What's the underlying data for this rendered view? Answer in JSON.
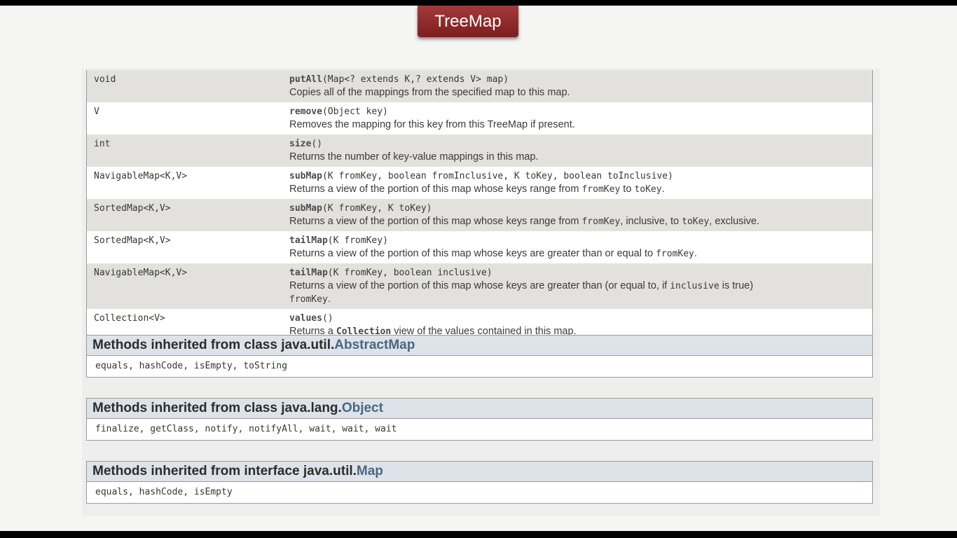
{
  "slide_title": "TreeMap",
  "methods": [
    {
      "type": "void",
      "name": "putAll",
      "params": "(Map<? extends K,? extends V> map)",
      "desc": [
        {
          "t": "Copies all of the mappings from the specified map to this map."
        }
      ]
    },
    {
      "type": "V",
      "name": "remove",
      "params": "(Object key)",
      "desc": [
        {
          "t": "Removes the mapping for this key from this TreeMap if present."
        }
      ]
    },
    {
      "type": "int",
      "name": "size",
      "params": "()",
      "desc": [
        {
          "t": "Returns the number of key-value mappings in this map."
        }
      ]
    },
    {
      "type": "NavigableMap<K,V>",
      "name": "subMap",
      "params": "(K fromKey, boolean fromInclusive, K toKey, boolean toInclusive)",
      "desc": [
        {
          "t": "Returns a view of the portion of this map whose keys range from "
        },
        {
          "t": "fromKey",
          "code": true
        },
        {
          "t": " to "
        },
        {
          "t": "toKey",
          "code": true
        },
        {
          "t": "."
        }
      ]
    },
    {
      "type": "SortedMap<K,V>",
      "name": "subMap",
      "params": "(K fromKey, K toKey)",
      "desc": [
        {
          "t": "Returns a view of the portion of this map whose keys range from "
        },
        {
          "t": "fromKey",
          "code": true
        },
        {
          "t": ", inclusive, to "
        },
        {
          "t": "toKey",
          "code": true
        },
        {
          "t": ", exclusive."
        }
      ]
    },
    {
      "type": "SortedMap<K,V>",
      "name": "tailMap",
      "params": "(K fromKey)",
      "desc": [
        {
          "t": "Returns a view of the portion of this map whose keys are greater than or equal to "
        },
        {
          "t": "fromKey",
          "code": true
        },
        {
          "t": "."
        }
      ]
    },
    {
      "type": "NavigableMap<K,V>",
      "name": "tailMap",
      "params": "(K fromKey, boolean inclusive)",
      "desc": [
        {
          "t": "Returns a view of the portion of this map whose keys are greater than (or equal to, if "
        },
        {
          "t": "inclusive",
          "code": true
        },
        {
          "t": " is true)"
        },
        {
          "br": true
        },
        {
          "t": "fromKey",
          "code": true
        },
        {
          "t": "."
        }
      ]
    },
    {
      "type": "Collection<V>",
      "name": "values",
      "params": "()",
      "desc": [
        {
          "t": "Returns a "
        },
        {
          "t": "Collection",
          "codeb": true
        },
        {
          "t": " view of the values contained in this map."
        }
      ]
    }
  ],
  "inherited": [
    {
      "prefix": "Methods inherited from class java.util.",
      "link": "AbstractMap",
      "methods": "equals, hashCode, isEmpty, toString"
    },
    {
      "prefix": "Methods inherited from class java.lang.",
      "link": "Object",
      "methods": "finalize, getClass, notify, notifyAll, wait, wait, wait"
    },
    {
      "prefix": "Methods inherited from interface java.util.",
      "link": "Map",
      "methods": "equals, hashCode, isEmpty"
    }
  ]
}
